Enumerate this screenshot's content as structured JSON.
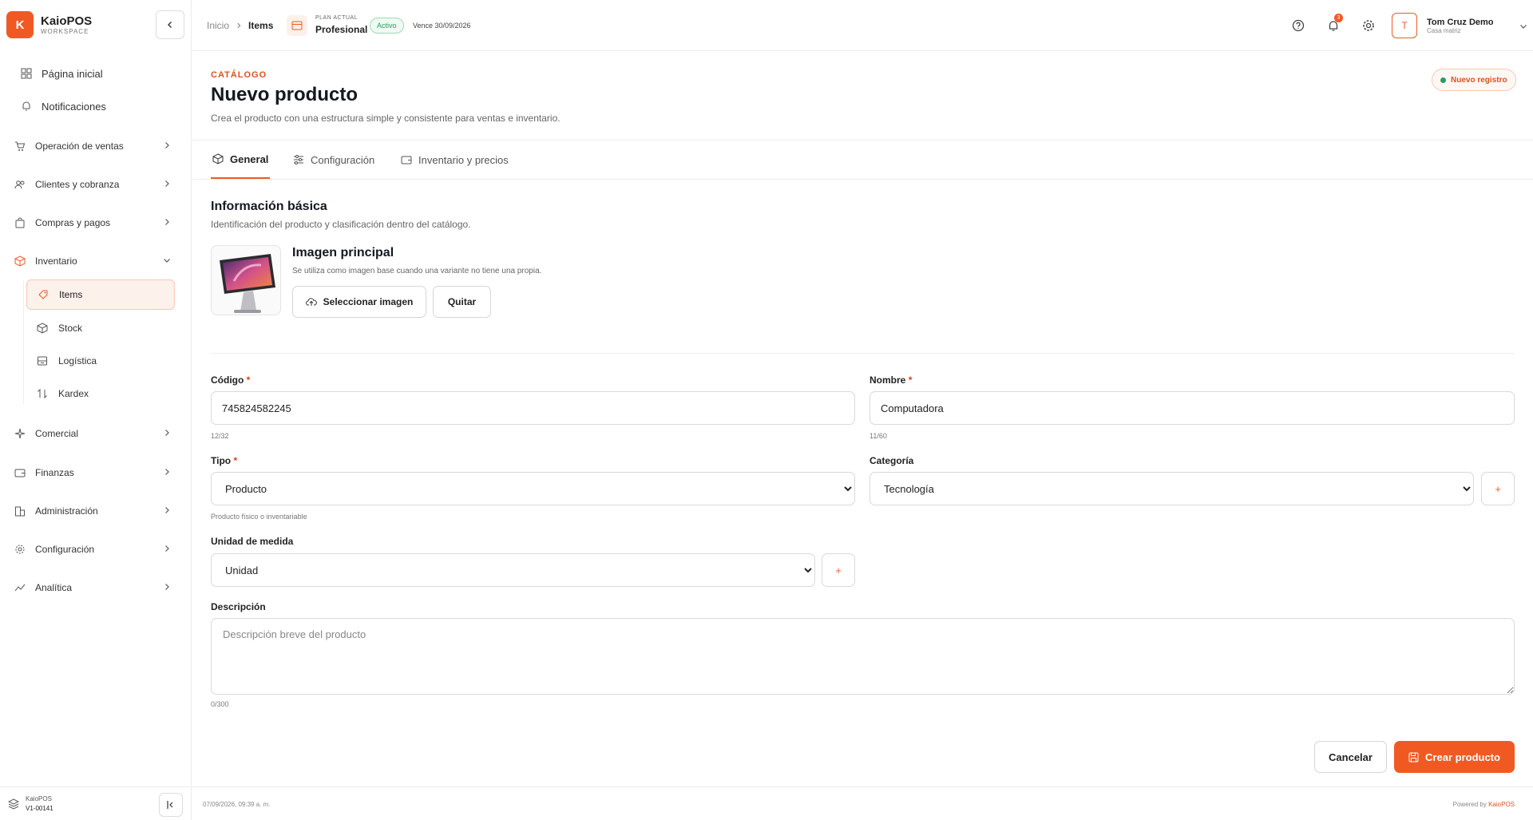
{
  "brand": {
    "logo_letter": "K",
    "name": "KaioPOS",
    "sub": "WORKSPACE"
  },
  "sidebar": {
    "top": [
      {
        "label": "Página inicial",
        "icon": "grid-icon"
      },
      {
        "label": "Notificaciones",
        "icon": "bell-icon"
      }
    ],
    "groups": [
      {
        "label": "Operación de ventas",
        "icon": "cart-icon"
      },
      {
        "label": "Clientes y cobranza",
        "icon": "users-icon"
      },
      {
        "label": "Compras y pagos",
        "icon": "bag-icon"
      },
      {
        "label": "Inventario",
        "icon": "box-icon"
      },
      {
        "label": "Comercial",
        "icon": "sparkle-icon"
      },
      {
        "label": "Finanzas",
        "icon": "wallet-icon"
      },
      {
        "label": "Administración",
        "icon": "building-icon"
      },
      {
        "label": "Configuración",
        "icon": "gear-icon"
      },
      {
        "label": "Analítica",
        "icon": "trend-icon"
      }
    ],
    "inventory_items": [
      {
        "label": "Items",
        "icon": "tag-icon",
        "active": true
      },
      {
        "label": "Stock",
        "icon": "cube-icon"
      },
      {
        "label": "Logística",
        "icon": "archive-icon"
      },
      {
        "label": "Kardex",
        "icon": "swap-icon"
      }
    ],
    "footer": {
      "name": "KaioPOS",
      "version": "V1-00141"
    }
  },
  "topbar": {
    "breadcrumb_home": "Inicio",
    "breadcrumb_current": "Items",
    "plan_label": "PLAN ACTUAL",
    "plan_name": "Profesional",
    "plan_status": "Activo",
    "expires": "Vence 30/09/2026",
    "notification_count": "3",
    "user_initial": "T",
    "user_name": "Tom Cruz Demo",
    "user_sub": "Casa matriz"
  },
  "page": {
    "eyebrow": "CATÁLOGO",
    "title": "Nuevo producto",
    "subtitle": "Crea el producto con una estructura simple y consistente para ventas e inventario.",
    "badge": "Nuevo registro",
    "badge_color": "#2a9d5c",
    "tabs": [
      {
        "label": "General",
        "icon": "cube-icon"
      },
      {
        "label": "Configuración",
        "icon": "sliders-icon"
      },
      {
        "label": "Inventario y precios",
        "icon": "wallet-icon"
      }
    ]
  },
  "form": {
    "section_title": "Información básica",
    "section_sub": "Identificación del producto y clasificación dentro del catálogo.",
    "image_title": "Imagen principal",
    "image_sub": "Se utiliza como imagen base cuando una variante no tiene una propia.",
    "select_image_label": "Seleccionar imagen",
    "remove_label": "Quitar",
    "code_label": "Código",
    "code_value": "745824582245",
    "code_counter": "12/32",
    "name_label": "Nombre",
    "name_value": "Computadora",
    "name_counter": "11/60",
    "type_label": "Tipo",
    "type_value": "Producto",
    "type_hint": "Producto físico o inventariable",
    "category_label": "Categoría",
    "category_value": "Tecnología",
    "unit_label": "Unidad de medida",
    "unit_value": "Unidad",
    "description_label": "Descripción",
    "description_placeholder": "Descripción breve del producto",
    "description_counter": "0/300",
    "required_mark": "*",
    "plus": "+"
  },
  "actions": {
    "cancel": "Cancelar",
    "create": "Crear producto"
  },
  "status_bar": {
    "timestamp": "07/09/2026, 09:39 a. m.",
    "powered_prefix": "Powered by",
    "powered_brand": "KaioPOS"
  },
  "colors": {
    "accent": "#f05a22",
    "active_green": "#2a9d5c"
  }
}
